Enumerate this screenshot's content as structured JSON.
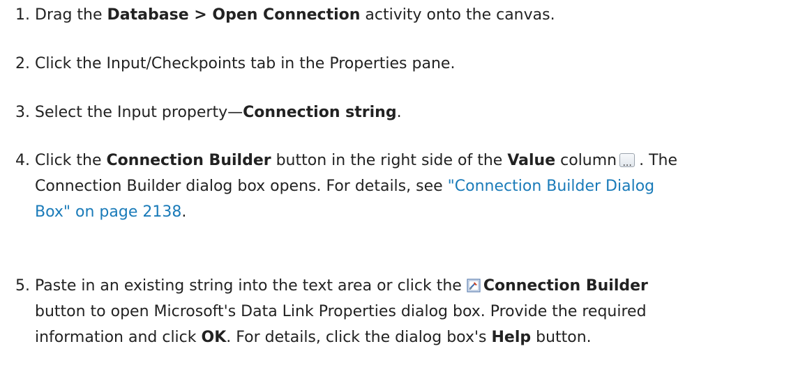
{
  "steps": [
    {
      "number": "1.",
      "t1": "Drag the ",
      "b1": "Database > Open Connection",
      "t2": " activity onto the canvas."
    },
    {
      "number": "2.",
      "t1": "Click the Input/Checkpoints tab in the Properties pane."
    },
    {
      "number": "3.",
      "t1": "Select the Input property—",
      "b1": "Connection string",
      "t2": "."
    },
    {
      "number": "4.",
      "t1": "Click the ",
      "b1": "Connection Builder",
      "t2": " button in the right side of the ",
      "b2": "Value",
      "t3": " column",
      "t4": ". The",
      "t5": "Connection Builder dialog box opens. For details, see ",
      "link1": "\"Connection Builder Dialog",
      "link2": "Box\" on page 2138",
      "t6": "."
    },
    {
      "number": "5.",
      "t1": "Paste in an existing string into the text area or click the ",
      "b1": "Connection Builder",
      "t2": "button to open Microsoft's Data Link Properties dialog box. Provide the required",
      "t3": "information and click ",
      "b2": "OK",
      "t4": ". For details, click the dialog box's ",
      "b3": "Help",
      "t5": " button."
    }
  ],
  "icons": {
    "ellipsis_button": "ellipsis-button-icon",
    "connection_builder": "connection-builder-icon"
  },
  "colors": {
    "text": "#222222",
    "link": "#1a7bb9"
  }
}
